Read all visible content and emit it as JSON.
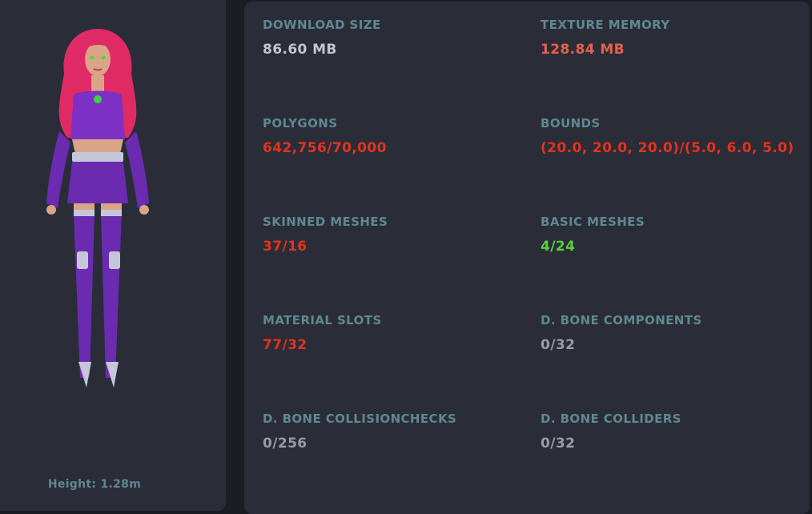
{
  "colors": {
    "label": "#5f8891",
    "neutral": "#c4c6cc",
    "muted": "#9a9ca2",
    "warning": "#e8604c",
    "error": "#e4321e",
    "good": "#58d23a"
  },
  "preview": {
    "height_label": "Height: 1.28m"
  },
  "stats": [
    {
      "label": "DOWNLOAD SIZE",
      "value": "86.60 MB",
      "status": "neutral"
    },
    {
      "label": "TEXTURE MEMORY",
      "value": "128.84 MB",
      "status": "warning"
    },
    {
      "label": "POLYGONS",
      "value": "642,756/70,000",
      "status": "error"
    },
    {
      "label": "BOUNDS",
      "value": "(20.0, 20.0, 20.0)/(5.0, 6.0, 5.0)",
      "status": "error"
    },
    {
      "label": "SKINNED MESHES",
      "value": "37/16",
      "status": "error"
    },
    {
      "label": "BASIC MESHES",
      "value": "4/24",
      "status": "good"
    },
    {
      "label": "MATERIAL SLOTS",
      "value": "77/32",
      "status": "error"
    },
    {
      "label": "D. BONE COMPONENTS",
      "value": "0/32",
      "status": "muted"
    },
    {
      "label": "D. BONE COLLISIONCHECKS",
      "value": "0/256",
      "status": "muted"
    },
    {
      "label": "D. BONE COLLIDERS",
      "value": "0/32",
      "status": "muted"
    }
  ]
}
